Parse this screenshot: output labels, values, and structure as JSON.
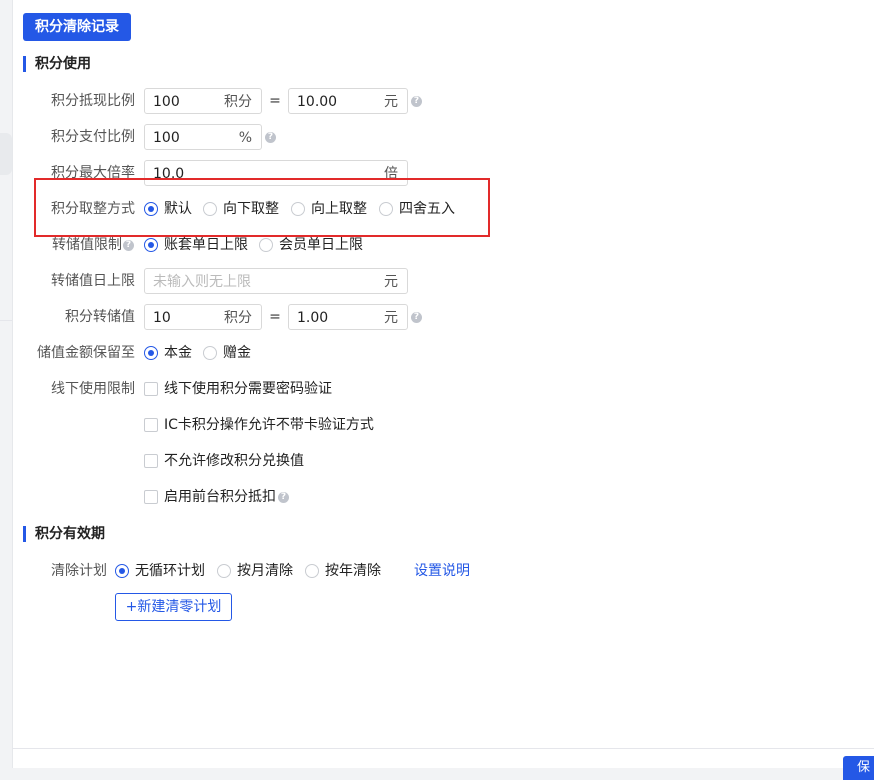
{
  "toolbar": {
    "clear_record_label": "积分清除记录"
  },
  "section_usage": {
    "title": "积分使用",
    "cash_ratio": {
      "label": "积分抵现比例",
      "points_value": "100",
      "points_unit": "积分",
      "equals": "=",
      "money_value": "10.00",
      "money_unit": "元"
    },
    "pay_ratio": {
      "label": "积分支付比例",
      "value": "100",
      "unit": "%"
    },
    "max_multiplier": {
      "label": "积分最大倍率",
      "value": "10.0",
      "unit": "倍"
    },
    "rounding": {
      "label": "积分取整方式",
      "options": [
        "默认",
        "向下取整",
        "向上取整",
        "四舍五入"
      ],
      "selected": "默认"
    },
    "transfer_limit": {
      "label": "转储值限制",
      "options": [
        "账套单日上限",
        "会员单日上限"
      ],
      "selected": "账套单日上限"
    },
    "transfer_daily_cap": {
      "label": "转储值日上限",
      "placeholder": "未输入则无上限",
      "unit": "元"
    },
    "points_transfer": {
      "label": "积分转储值",
      "points_value": "10",
      "points_unit": "积分",
      "equals": "=",
      "money_value": "1.00",
      "money_unit": "元"
    },
    "reserve_to": {
      "label": "储值金额保留至",
      "options": [
        "本金",
        "赠金"
      ],
      "selected": "本金"
    },
    "offline_limit": {
      "label": "线下使用限制",
      "checkboxes": [
        "线下使用积分需要密码验证",
        "IC卡积分操作允许不带卡验证方式",
        "不允许修改积分兑换值",
        "启用前台积分抵扣"
      ]
    }
  },
  "section_validity": {
    "title": "积分有效期",
    "clear_plan": {
      "label": "清除计划",
      "options": [
        "无循环计划",
        "按月清除",
        "按年清除"
      ],
      "selected": "无循环计划"
    },
    "setting_link": "设置说明",
    "new_plan_button": "+新建清零计划"
  },
  "footer": {
    "save_label": "保"
  },
  "colors": {
    "primary": "#2458e6",
    "highlight_border": "#e22a2a"
  }
}
